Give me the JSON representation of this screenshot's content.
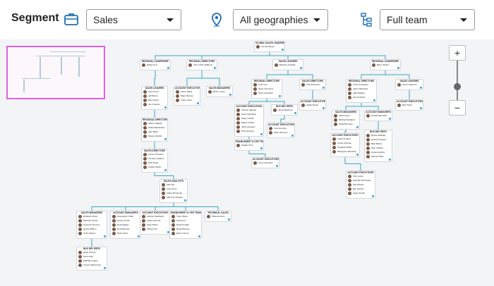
{
  "toolbar": {
    "title": "Segment",
    "segment_select": "Sales",
    "geo_select": "All geographies",
    "team_select": "Full team",
    "icons": {
      "segment": "briefcase-icon",
      "geo": "location-pin-icon",
      "team": "org-tree-icon"
    },
    "accent": "#1f6fb5"
  },
  "zoom": {
    "in_label": "+",
    "out_label": "−"
  },
  "colors": {
    "link": "#3aa7c7",
    "minimap_border": "#e060e0"
  },
  "nodes": [
    {
      "id": "root",
      "title": "GLOBAL SALES LEADERSHIP",
      "sub": "",
      "people": [
        "Joe Montaney"
      ]
    },
    {
      "id": "rl1",
      "title": "REGIONAL LEADERSHIP",
      "sub": "",
      "people": [
        "Eddie Ford"
      ]
    },
    {
      "id": "rd1",
      "title": "REGIONAL DIRECTORS",
      "sub": "",
      "people": [
        "John 'Jack' Walbrow"
      ]
    },
    {
      "id": "sl1",
      "title": "SALES LEADERS",
      "sub": "",
      "people": [
        "Brandon Franklin"
      ]
    },
    {
      "id": "rl2",
      "title": "REGIONAL LEADERSHIP",
      "sub": "",
      "people": [
        "Barry Tobias"
      ]
    },
    {
      "id": "sl2",
      "title": "SALES LEADERS",
      "sub": "",
      "people": [
        "Luke Pond",
        "Jeff Burns",
        "Ellen Dyett",
        "Jen Jimenez"
      ]
    },
    {
      "id": "ae1",
      "title": "ACCOUNT EXECUTIVES",
      "sub": "",
      "people": [
        "Aaron Hilley",
        "Brian Moreno",
        "Colby Gavin"
      ]
    },
    {
      "id": "sm1",
      "title": "SALES MANAGERS",
      "sub": "",
      "people": [
        "Bruno Lowry"
      ]
    },
    {
      "id": "rd2",
      "title": "REGIONAL DIRECTORS",
      "sub": "",
      "people": [
        "Colin Lau",
        "Helen Summers",
        "Scott Campbell"
      ]
    },
    {
      "id": "sd1",
      "title": "SALES DIRECTORS",
      "sub": "",
      "people": [
        "Tina Robinson"
      ]
    },
    {
      "id": "rd3",
      "title": "REGIONAL DIRECTORS",
      "sub": "",
      "people": [
        "Chris Troppleton",
        "Jason Maxwells",
        "Jack Bradley",
        "Nat O'Hollins"
      ]
    },
    {
      "id": "sl3",
      "title": "SALES LEADERS",
      "sub": "",
      "people": [
        "Gavin Newman"
      ]
    },
    {
      "id": "rd4",
      "title": "REGIONAL DIRECTORS",
      "sub": "",
      "people": [
        "Gibby Cadwell",
        "Stella Wanderlust",
        "Alan Berle",
        "Nasser Neville"
      ]
    },
    {
      "id": "ae2",
      "title": "ACCOUNT EXECUTIVES",
      "sub": "",
      "people": [
        "Antonio Iglesius",
        "Scott Campbell",
        "Stacy O'Neill",
        "Mason Fisher",
        "Janie Lebeaux",
        "Rina Harrison"
      ]
    },
    {
      "id": "bd1",
      "title": "BUS DEV REPS",
      "sub": "",
      "people": [
        "Janet Stephens"
      ]
    },
    {
      "id": "ae3",
      "title": "ACCOUNT EXECUTIVES",
      "sub": "",
      "people": [
        "Lisa Gunning",
        "Allan Jameson"
      ]
    },
    {
      "id": "ae4",
      "title": "ACCOUNT EXECUTIVES",
      "sub": "",
      "people": [
        "Isaiah Brown"
      ]
    },
    {
      "id": "sm2",
      "title": "SALES MANAGERS",
      "sub": "",
      "people": [
        "Lillian Rose",
        "Michael DeMarco",
        "Nellie Brennan"
      ]
    },
    {
      "id": "am1",
      "title": "ACCOUNT MANAGERS",
      "sub": "",
      "people": [
        "Newell Marmalis"
      ]
    },
    {
      "id": "ae5",
      "title": "ACCOUNT EXECUTIVES",
      "sub": "",
      "people": [
        "Bud Tinker"
      ]
    },
    {
      "id": "bd2",
      "title": "BUS DEV REPS",
      "sub": "",
      "people": [
        "Nicole Wolfhart",
        "Hannah Gregen",
        "Beth Barret",
        "Stan O'Brian",
        "Kayla Hopkins",
        "Marina Tuttle"
      ]
    },
    {
      "id": "ae6",
      "title": "ACCOUNT EXECUTIVES",
      "sub": "",
      "people": [
        "Frank de Beer",
        "Lucas Lillymae",
        "Jonathan Rallis",
        "Marsgaret McCarthy"
      ]
    },
    {
      "id": "en1",
      "title": "ENABLEMENT & OPS TEAM",
      "sub": "",
      "people": [
        "Natalie Orrin"
      ]
    },
    {
      "id": "ae7",
      "title": "ACCOUNT EXECUTIVES",
      "sub": "",
      "people": [
        "Scott Campbell"
      ]
    },
    {
      "id": "ae8",
      "title": "ACCOUNT EXECUTIVES",
      "sub": "",
      "people": [
        "Toby Lewis",
        "Kamilah Schroeder",
        "Sari Davids",
        "Ben Jacobs",
        "Isaac Harrell"
      ]
    },
    {
      "id": "sd2",
      "title": "SALES DIRECTORS",
      "sub": "",
      "people": [
        "Lauren Schwarz",
        "Timothy Gaskins",
        "Nick Rossi",
        "Charlie Sharp"
      ]
    },
    {
      "id": "sa1",
      "title": "SALES ANALYSTS",
      "sub": "",
      "people": [
        "Alan Wu",
        "Luke Chan",
        "Adam Dimanche",
        "Albert de Fayette"
      ]
    },
    {
      "id": "sm3",
      "title": "SALES MANAGERS",
      "sub": "",
      "people": [
        "Elizabeth Ryan",
        "Michelle Tanner",
        "Cameron Rooney",
        "Harris Willson",
        "Jimbo Reyes"
      ]
    },
    {
      "id": "am2",
      "title": "ACCOUNT MANAGERS",
      "sub": "",
      "people": [
        "Gwendolyn Odell",
        "Quincy Smith",
        "Nina Edgars",
        "Emil Branson",
        "Peter Scott"
      ]
    },
    {
      "id": "ae9",
      "title": "ACCOUNT EXECUTIVES",
      "sub": "",
      "people": [
        "Andrew Sandback",
        "Angie Aymond",
        "Jules Reins",
        "Shirley Fitz"
      ]
    },
    {
      "id": "en2",
      "title": "ENABLEMENT & OPS TEAM",
      "sub": "",
      "people": [
        "Tracy Wiest",
        "Hannah Li",
        "Daniel Knight",
        "David Monroe",
        "Ebony Gross"
      ]
    },
    {
      "id": "ts1",
      "title": "TECHNICAL SALES",
      "sub": "",
      "people": [
        "Shauna Gehy"
      ]
    },
    {
      "id": "bd3",
      "title": "BUS DEV REPS",
      "sub": "",
      "people": [
        "Haley Cheng",
        "Scott Jean",
        "Matthias Logan",
        "Lauren Matsumoto"
      ]
    }
  ]
}
